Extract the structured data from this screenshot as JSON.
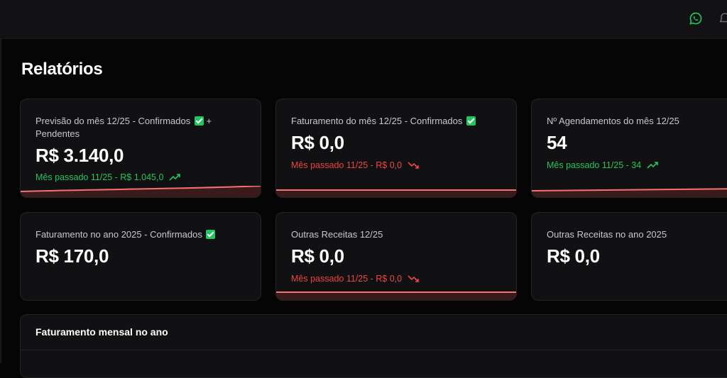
{
  "topbar": {
    "icons": [
      "whatsapp-icon",
      "bell-icon"
    ],
    "whatsapp_color": "#22c55e"
  },
  "page": {
    "title": "Relatórios"
  },
  "cards": [
    {
      "label": "Previsão do mês 12/25 - Confirmados",
      "label_suffix": "+ Pendentes",
      "value": "R$ 3.140,0",
      "trend_text": "Mês passado 11/25 - R$ 1.045,0",
      "trend": "up",
      "has_check": true
    },
    {
      "label": "Faturamento do mês 12/25 - Confirmados",
      "value": "R$ 0,0",
      "trend_text": "Mês passado 11/25 - R$ 0,0",
      "trend": "down",
      "has_check": true
    },
    {
      "label": "Nº Agendamentos do mês 12/25",
      "value": "54",
      "trend_text": "Mês passado 11/25 - 34",
      "trend": "up",
      "has_check": false
    },
    {
      "label": "Faturamento no ano 2025 - Confirmados",
      "value": "R$ 170,0",
      "has_check": true
    },
    {
      "label": "Outras Receitas 12/25",
      "value": "R$ 0,0",
      "trend_text": "Mês passado 11/25 - R$ 0,0",
      "trend": "down",
      "has_check": false
    },
    {
      "label": "Outras Receitas no ano 2025",
      "value": "R$ 0,0",
      "has_check": false
    }
  ],
  "panel": {
    "title": "Faturamento mensal no ano"
  },
  "colors": {
    "background": "#050505",
    "card": "#111113",
    "up": "#22c55e",
    "down": "#ef4444",
    "accent_line": "#f87171"
  }
}
